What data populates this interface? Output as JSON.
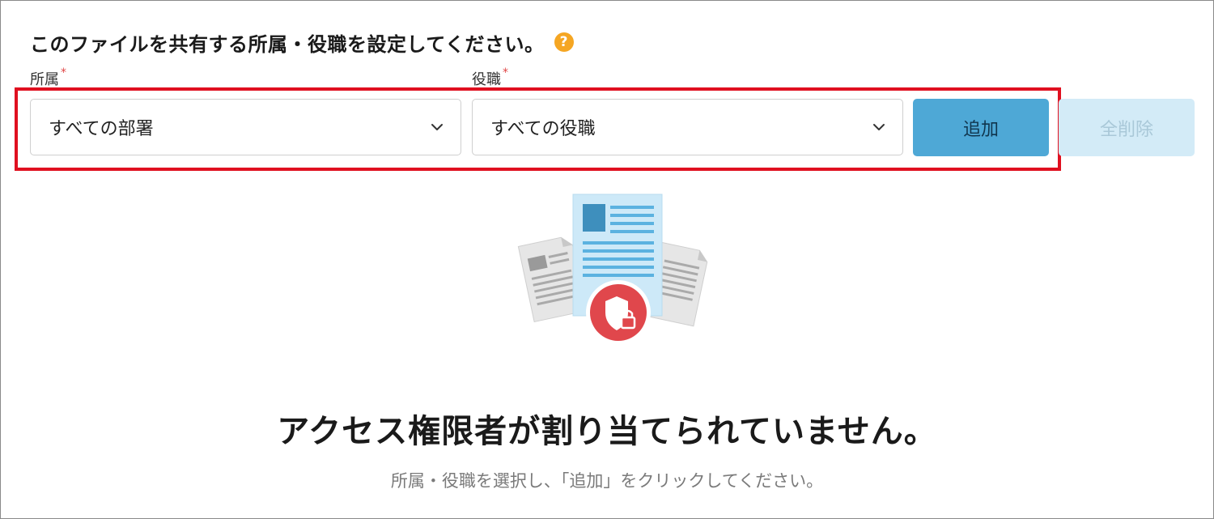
{
  "header": {
    "title": "このファイルを共有する所属・役職を設定してください。",
    "help_icon": "question-circle-icon",
    "help_symbol": "?"
  },
  "affiliation": {
    "label": "所属",
    "required_mark": "*",
    "selected": "すべての部署",
    "icon": "chevron-down-icon"
  },
  "position": {
    "label": "役職",
    "required_mark": "*",
    "selected": "すべての役職",
    "icon": "chevron-down-icon"
  },
  "actions": {
    "add_label": "追加",
    "clear_all_label": "全削除"
  },
  "empty_state": {
    "illustration": "shared-documents-lock-illustration",
    "title": "アクセス権限者が割り当てられていません。",
    "subtitle": "所属・役職を選択し、「追加」をクリックしてください。"
  },
  "colors": {
    "accent": "#4ea8d6",
    "accent_disabled": "#d3ebf7",
    "highlight_border": "#e01020",
    "required": "#e04646",
    "help": "#f5a623",
    "lock_badge": "#e0474c"
  }
}
